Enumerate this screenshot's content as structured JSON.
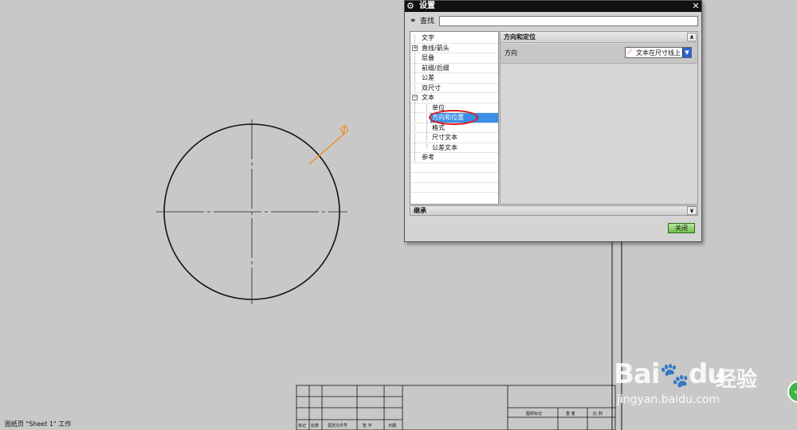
{
  "dialog": {
    "title": "设置",
    "find_label": "查找",
    "find_value": "",
    "tree": [
      {
        "label": "文字"
      },
      {
        "label": "直线/箭头"
      },
      {
        "label": "层叠"
      },
      {
        "label": "前缀/后缀"
      },
      {
        "label": "公差"
      },
      {
        "label": "双尺寸"
      },
      {
        "label": "文本"
      },
      {
        "label": "单位"
      },
      {
        "label": "方向和位置"
      },
      {
        "label": "格式"
      },
      {
        "label": "尺寸文本"
      },
      {
        "label": "公差文本"
      },
      {
        "label": "参考"
      }
    ],
    "group_title": "方向和定位",
    "direction_label": "方向",
    "direction_value": "文本在尺寸线上",
    "inherit_title": "继承",
    "close_label": "关闭"
  },
  "status_bar": "图纸页 \"Sheet 1\" 工作",
  "title_block": {
    "bottom_labels": [
      "标记",
      "处数",
      "更改文件号",
      "签 字",
      "日期"
    ],
    "right_labels": [
      "图样标记",
      "重 量",
      "比 例"
    ]
  },
  "watermark": {
    "brand": "Bai",
    "brand2": "du",
    "cn": "经验",
    "url": "jingyan.baidu.com"
  },
  "icons": {
    "settings": "gear-icon",
    "close": "close-icon",
    "find": "binoculars-icon",
    "direction": "text-on-dimension-icon"
  },
  "colors": {
    "selection": "#3a8ee6",
    "highlight_oval": "#e21b1b",
    "leader": "#f08c1a",
    "close_button": "#70c048"
  }
}
